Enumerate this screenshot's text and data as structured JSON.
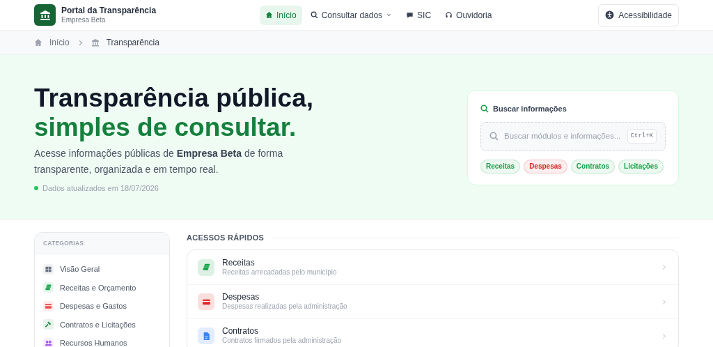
{
  "header": {
    "title": "Portal da Transparência",
    "subtitle": "Empresa Beta"
  },
  "nav": [
    {
      "label": "Início",
      "selected": true,
      "dropdown": false
    },
    {
      "label": "Consultar dados",
      "selected": false,
      "dropdown": true
    },
    {
      "label": "SIC",
      "selected": false,
      "dropdown": false
    },
    {
      "label": "Ouvidoria",
      "selected": false,
      "dropdown": false
    }
  ],
  "accessibility_button": "Acessibilidade",
  "breadcrumb": [
    {
      "label": "Início"
    },
    {
      "label": "Transparência"
    }
  ],
  "hero": {
    "title_line_1": "Transparência pública,",
    "title_line_2": "simples de consultar.",
    "description": "Acesse informações públicas de **Empresa Beta** de forma transparente, organizada e em tempo real.",
    "updated": "Dados atualizados em 18/07/2026"
  },
  "search_card": {
    "title": "Buscar informações",
    "placeholder": "Buscar módulos e informações...",
    "shortcut": "Ctrl+K",
    "chips": [
      {
        "label": "Receitas",
        "color": "#16a34a"
      },
      {
        "label": "Despesas",
        "color": "#dc2626"
      },
      {
        "label": "Contratos",
        "color": "#16a34a"
      },
      {
        "label": "Licitações",
        "color": "#16a34a"
      }
    ]
  },
  "categories": {
    "title": "CATEGORIAS",
    "items": [
      {
        "label": "Visão Geral",
        "color": "#6b7280"
      },
      {
        "label": "Receitas e Orçamento",
        "color": "#16a34a"
      },
      {
        "label": "Despesas e Gastos",
        "color": "#ef4444"
      },
      {
        "label": "Contratos e Licitações",
        "color": "#15803d"
      },
      {
        "label": "Recursos Humanos",
        "color": "#a855f7"
      }
    ]
  },
  "quick_access": {
    "title": "ACESSOS RÁPIDOS",
    "items": [
      {
        "title": "Receitas",
        "subtitle": "Receitas arrecadadas pelo município",
        "color": "#16a34a"
      },
      {
        "title": "Despesas",
        "subtitle": "Despesas realizadas pela administração",
        "color": "#dc2626"
      },
      {
        "title": "Contratos",
        "subtitle": "Contratos firmados pela administração",
        "color": "#3b82f6"
      }
    ]
  }
}
